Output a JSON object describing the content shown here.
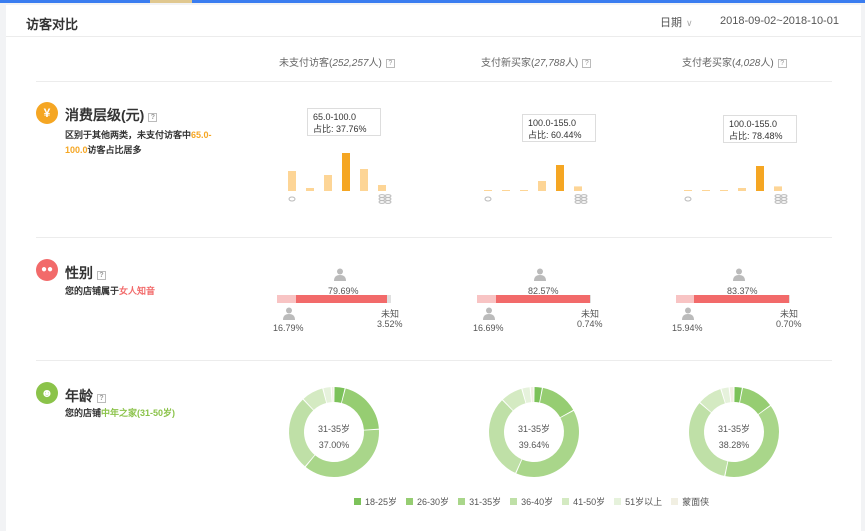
{
  "header": {
    "title": "访客对比",
    "date_label": "日期",
    "date_range": "2018-09-02~2018-10-01"
  },
  "columns": [
    {
      "label_prefix": "未支付访客(",
      "count": "252,257",
      "label_suffix": "人)",
      "help": "?"
    },
    {
      "label_prefix": "支付新买家(",
      "count": "27,788",
      "label_suffix": "人)",
      "help": "?"
    },
    {
      "label_prefix": "支付老买家(",
      "count": "4,028",
      "label_suffix": "人)",
      "help": "?"
    }
  ],
  "consumption": {
    "icon": "¥",
    "title": "消费层级(元)",
    "desc_pre": "区别于其他两类，未支付访客中",
    "desc_hl": "65.0-100.0",
    "desc_post": "访客占比居多",
    "colors": {
      "light": "#fdd596",
      "dark": "#f5a623"
    },
    "charts": [
      {
        "tip_range": "65.0-100.0",
        "tip_ratio": "占比: 37.76%",
        "values": [
          10,
          1.5,
          8,
          19,
          11,
          3
        ],
        "highlight": 3
      },
      {
        "tip_range": "100.0-155.0",
        "tip_ratio": "占比: 60.44%",
        "values": [
          0.3,
          0.3,
          0.3,
          5,
          13,
          2.3
        ],
        "highlight": 4
      },
      {
        "tip_range": "100.0-155.0",
        "tip_ratio": "占比: 78.48%",
        "values": [
          0.3,
          0.3,
          0.3,
          1.5,
          12.5,
          2.3
        ],
        "highlight": 4
      }
    ]
  },
  "gender": {
    "title": "性别",
    "desc_pre": "您的店铺属于",
    "desc_hl": "女人知音",
    "colors": {
      "female": "#f26a6a",
      "male": "#f8c4c4",
      "unknown": "#e0e0e0"
    },
    "unknown_label": "未知",
    "charts": [
      {
        "female": "79.69%",
        "male": "16.79%",
        "unknown": "3.52%",
        "female_v": 79.69,
        "male_v": 16.79,
        "unknown_v": 3.52
      },
      {
        "female": "82.57%",
        "male": "16.69%",
        "unknown": "0.74%",
        "female_v": 82.57,
        "male_v": 16.69,
        "unknown_v": 0.74
      },
      {
        "female": "83.37%",
        "male": "15.94%",
        "unknown": "0.70%",
        "female_v": 83.37,
        "male_v": 15.94,
        "unknown_v": 0.7
      }
    ]
  },
  "age": {
    "title": "年龄",
    "desc_pre": "您的店铺",
    "desc_hl": "中年之家(31-50岁)",
    "charts": [
      {
        "center_label": "31-35岁",
        "center_value": "37.00%",
        "values": [
          4,
          20,
          37,
          27,
          8,
          3,
          1
        ]
      },
      {
        "center_label": "31-35岁",
        "center_value": "39.64%",
        "values": [
          3,
          14,
          39.64,
          31,
          8,
          3,
          1.36
        ]
      },
      {
        "center_label": "31-35岁",
        "center_value": "38.28%",
        "values": [
          3,
          12,
          38.28,
          33,
          9,
          3,
          1.72
        ]
      }
    ],
    "legend": [
      {
        "label": "18-25岁",
        "color": "#7cc25a"
      },
      {
        "label": "26-30岁",
        "color": "#96cd72"
      },
      {
        "label": "31-35岁",
        "color": "#a9d68a"
      },
      {
        "label": "36-40岁",
        "color": "#bfe0a7"
      },
      {
        "label": "41-50岁",
        "color": "#d4eac2"
      },
      {
        "label": "51岁以上",
        "color": "#e6f2dc"
      },
      {
        "label": "蒙面侠",
        "color": "#f1efe2"
      }
    ]
  },
  "icons": {
    "help": "help-icon",
    "yen": "yen-icon",
    "people": "people-icon",
    "person": "person-icon",
    "coins": "coins-icon"
  }
}
